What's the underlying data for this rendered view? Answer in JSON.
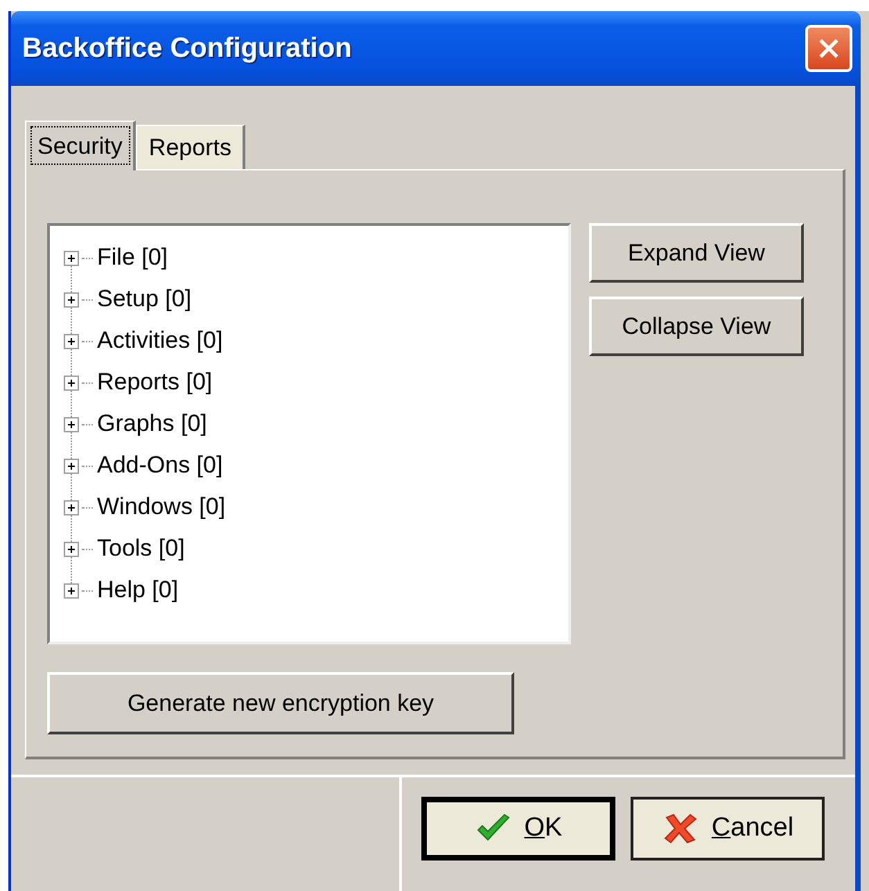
{
  "window": {
    "title": "Backoffice Configuration"
  },
  "tabs": [
    {
      "label": "Security",
      "selected": true
    },
    {
      "label": "Reports",
      "selected": false
    }
  ],
  "tree": {
    "items": [
      {
        "label": "File [0]",
        "expanded": false
      },
      {
        "label": "Setup [0]",
        "expanded": false
      },
      {
        "label": "Activities [0]",
        "expanded": false
      },
      {
        "label": "Reports [0]",
        "expanded": false
      },
      {
        "label": "Graphs [0]",
        "expanded": false
      },
      {
        "label": "Add-Ons [0]",
        "expanded": false
      },
      {
        "label": "Windows [0]",
        "expanded": false
      },
      {
        "label": "Tools [0]",
        "expanded": false
      },
      {
        "label": "Help [0]",
        "expanded": false
      }
    ]
  },
  "side_buttons": [
    "Expand View",
    "Collapse View"
  ],
  "generate_button": "Generate new encryption key",
  "footer_buttons": [
    {
      "kind": "ok",
      "label": "OK",
      "default": true
    },
    {
      "kind": "cancel",
      "label": "Cancel",
      "default": false
    }
  ]
}
